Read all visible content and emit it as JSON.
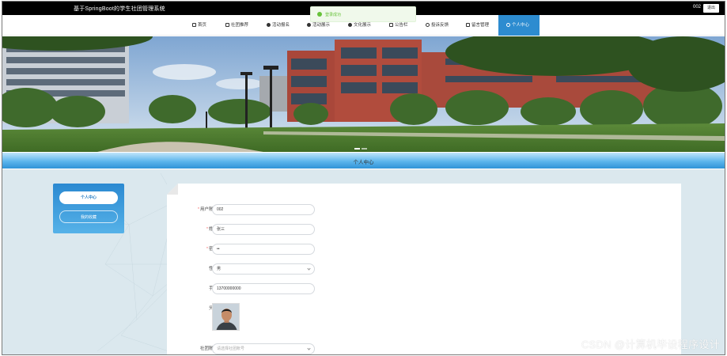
{
  "header": {
    "site_title": "基于SpringBoot的学生社团管理系统",
    "username": "002",
    "logout_label": "退出"
  },
  "toast": {
    "message": "登录成功"
  },
  "nav": {
    "items": [
      {
        "label": "首页",
        "icon": "home-icon"
      },
      {
        "label": "社团推荐",
        "icon": "flag-icon"
      },
      {
        "label": "活动报名",
        "icon": "circle-icon"
      },
      {
        "label": "活动展示",
        "icon": "circle-icon"
      },
      {
        "label": "文化展示",
        "icon": "circle-icon"
      },
      {
        "label": "公告栏",
        "icon": "doc-icon"
      },
      {
        "label": "投诉反馈",
        "icon": "chat-icon"
      },
      {
        "label": "留言管理",
        "icon": "message-icon"
      },
      {
        "label": "个人中心",
        "icon": "user-icon",
        "active": true
      }
    ]
  },
  "section": {
    "title": "个人中心"
  },
  "side_menu": {
    "items": [
      {
        "label": "个人中心",
        "active": true
      },
      {
        "label": "我的收藏",
        "active": false
      }
    ]
  },
  "form": {
    "account": {
      "label": "用户账号",
      "value": "002",
      "required": true
    },
    "name": {
      "label": "姓名",
      "value": "张三",
      "required": true
    },
    "password": {
      "label": "密码",
      "value": "••",
      "required": true
    },
    "gender": {
      "label": "性别",
      "value": "男"
    },
    "phone": {
      "label": "手机",
      "value": "13700000000"
    },
    "avatar": {
      "label": "头像"
    },
    "club_account": {
      "label": "社团账号",
      "placeholder": "请选择社团账号"
    }
  },
  "watermark": "CSDN @计算机毕设程序设计"
}
